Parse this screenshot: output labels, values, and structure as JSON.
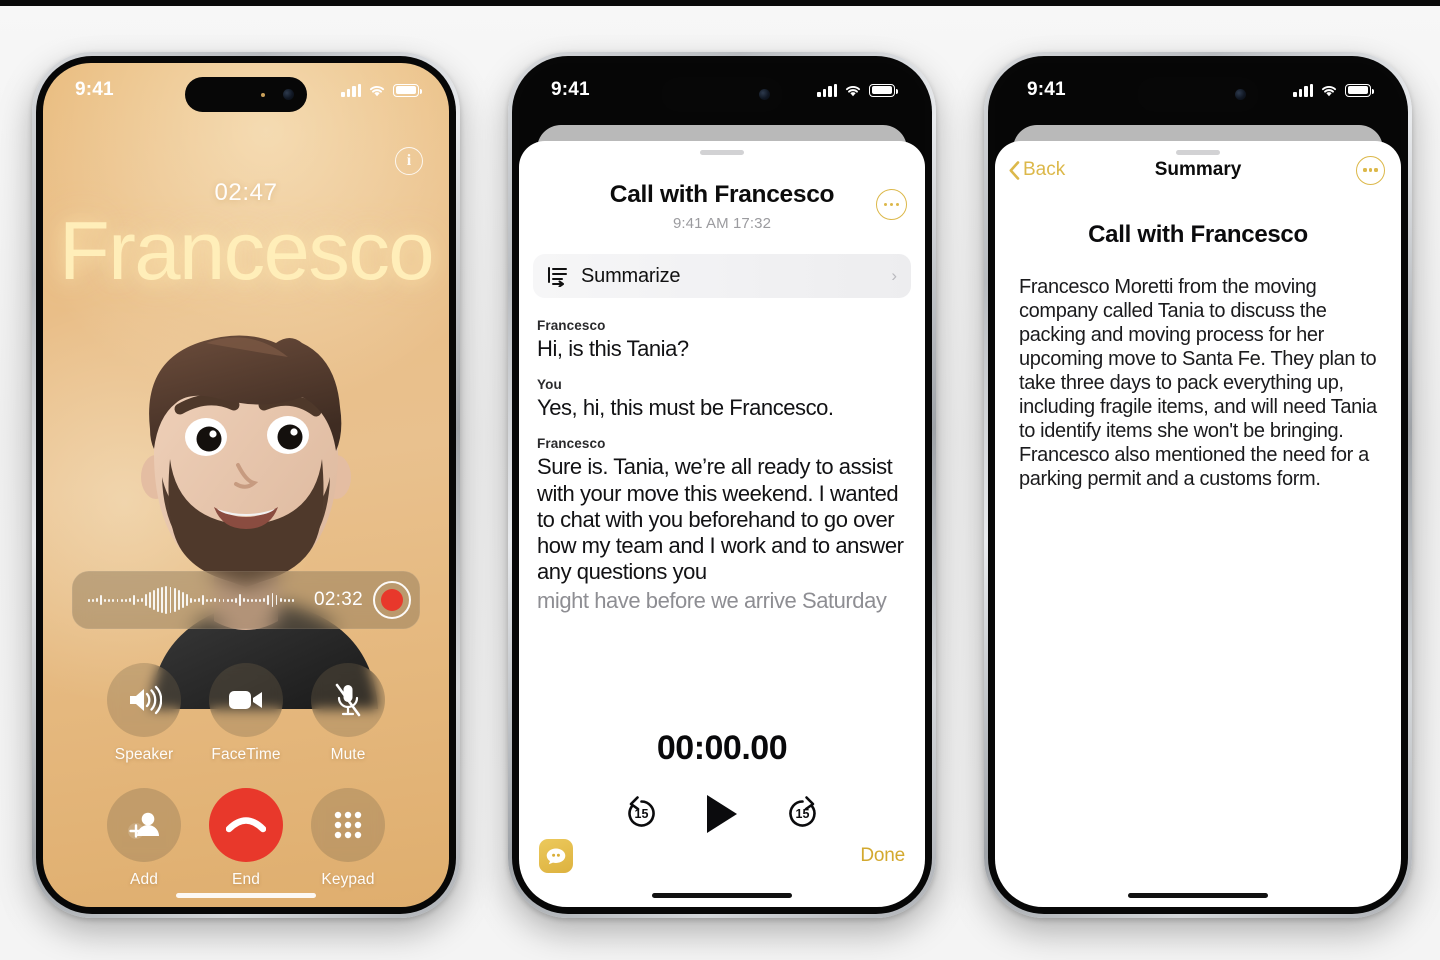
{
  "phone1": {
    "statusbar": {
      "time": "9:41",
      "signal_icon": "cellular-bars-icon",
      "wifi_icon": "wifi-icon",
      "battery_icon": "battery-icon"
    },
    "info_button": {
      "label": "i",
      "name": "call-info-button"
    },
    "call_timer": "02:47",
    "caller_name": "Francesco",
    "recording": {
      "elapsed": "02:32",
      "record_button": "stop-recording-button",
      "waveform": "audio-waveform"
    },
    "controls": [
      {
        "label": "Speaker",
        "icon": "speaker-icon"
      },
      {
        "label": "FaceTime",
        "icon": "video-camera-icon"
      },
      {
        "label": "Mute",
        "icon": "microphone-muted-icon"
      },
      {
        "label": "Add",
        "icon": "add-person-icon"
      },
      {
        "label": "End",
        "icon": "end-call-icon"
      },
      {
        "label": "Keypad",
        "icon": "keypad-icon"
      }
    ]
  },
  "phone2": {
    "statusbar": {
      "time": "9:41"
    },
    "title": "Call with Francesco",
    "subtitle": "9:41 AM  17:32",
    "more_button": "more-options-button",
    "summarize": {
      "label": "Summarize",
      "icon": "summarize-icon",
      "chevron": "›"
    },
    "transcript": [
      {
        "speaker": "Francesco",
        "text": "Hi, is this Tania?",
        "faded": false
      },
      {
        "speaker": "You",
        "text": "Yes, hi, this must be Francesco.",
        "faded": false
      },
      {
        "speaker": "Francesco",
        "text": "Sure is. Tania, we’re all ready to assist with your move this weekend. I wanted to chat with you beforehand to go over how my team and I work and to answer any questions you",
        "faded": false
      },
      {
        "speaker": "",
        "text": "might have before we arrive Saturday",
        "faded": true
      }
    ],
    "player": {
      "time": "00:00.00",
      "back_label": "15",
      "forward_label": "15",
      "play_icon": "play-icon",
      "back_icon": "skip-back-15-icon",
      "forward_icon": "skip-forward-15-icon"
    },
    "footer": {
      "messages_icon": "messages-app-icon",
      "done_label": "Done"
    }
  },
  "phone3": {
    "statusbar": {
      "time": "9:41"
    },
    "back_label": "Back",
    "nav_title": "Summary",
    "more_button": "more-options-button",
    "title": "Call with Francesco",
    "body": "Francesco Moretti from the moving company called Tania to discuss the packing and moving process for her upcoming move to Santa Fe. They plan to take three days to pack everything up, including fragile items, and will need Tania to identify items she won't be bringing. Francesco also mentioned the need for a parking permit and a customs form."
  },
  "colors": {
    "accent_gold": "#dcb84a",
    "done_gold": "#d3a92f",
    "end_call_red": "#e8382b",
    "wallpaper_amber": "#e8b878"
  }
}
